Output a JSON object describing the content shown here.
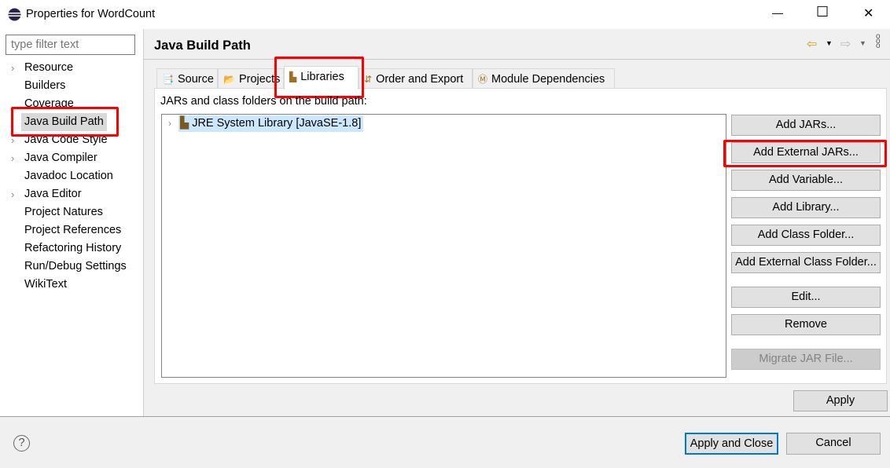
{
  "window": {
    "title": "Properties for WordCount",
    "minimize": "—",
    "maximize": "☐",
    "close": "✕"
  },
  "sidebar": {
    "filter_placeholder": "type filter text",
    "items": [
      {
        "label": "Resource",
        "expandable": true
      },
      {
        "label": "Builders",
        "expandable": false
      },
      {
        "label": "Coverage",
        "expandable": false
      },
      {
        "label": "Java Build Path",
        "expandable": false,
        "selected": true
      },
      {
        "label": "Java Code Style",
        "expandable": true
      },
      {
        "label": "Java Compiler",
        "expandable": true
      },
      {
        "label": "Javadoc Location",
        "expandable": false
      },
      {
        "label": "Java Editor",
        "expandable": true
      },
      {
        "label": "Project Natures",
        "expandable": false
      },
      {
        "label": "Project References",
        "expandable": false
      },
      {
        "label": "Refactoring History",
        "expandable": false
      },
      {
        "label": "Run/Debug Settings",
        "expandable": false
      },
      {
        "label": "WikiText",
        "expandable": false
      }
    ]
  },
  "page": {
    "title": "Java Build Path",
    "tabs": [
      {
        "label": "Source"
      },
      {
        "label": "Projects"
      },
      {
        "label": "Libraries",
        "active": true
      },
      {
        "label": "Order and Export"
      },
      {
        "label": "Module Dependencies"
      }
    ],
    "description": "JARs and class folders on the build path:",
    "tree": [
      {
        "label": "JRE System Library [JavaSE-1.8]"
      }
    ],
    "buttons": [
      {
        "label": "Add JARs..."
      },
      {
        "label": "Add External JARs..."
      },
      {
        "label": "Add Variable..."
      },
      {
        "label": "Add Library..."
      },
      {
        "label": "Add Class Folder..."
      },
      {
        "label": "Add External Class Folder..."
      },
      {
        "label": "Edit..."
      },
      {
        "label": "Remove"
      },
      {
        "label": "Migrate JAR File...",
        "disabled": true
      }
    ],
    "apply": "Apply"
  },
  "footer": {
    "apply_close": "Apply and Close",
    "cancel": "Cancel",
    "help": "?"
  },
  "colors": {
    "highlight": "#ff0000",
    "selection": "#cce8ff",
    "default_button_border": "#0078d7"
  }
}
